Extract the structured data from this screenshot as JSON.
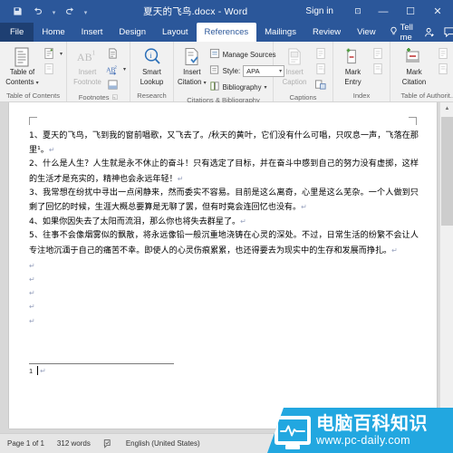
{
  "titlebar": {
    "document_title": "夏天的飞鸟.docx  -  Word",
    "signin_label": "Sign in",
    "qat": [
      {
        "name": "save",
        "icon": "save-icon"
      },
      {
        "name": "undo",
        "icon": "undo-icon"
      },
      {
        "name": "redo",
        "icon": "redo-icon"
      },
      {
        "name": "customize",
        "icon": "chevron-down-icon"
      }
    ],
    "window_controls": {
      "ribbon_display": "⊡",
      "minimize": "—",
      "maximize": "☐",
      "close": "✕"
    }
  },
  "tabs": [
    {
      "label": "File",
      "active": false,
      "file": true
    },
    {
      "label": "Home",
      "active": false
    },
    {
      "label": "Insert",
      "active": false
    },
    {
      "label": "Design",
      "active": false
    },
    {
      "label": "Layout",
      "active": false
    },
    {
      "label": "References",
      "active": true
    },
    {
      "label": "Mailings",
      "active": false
    },
    {
      "label": "Review",
      "active": false
    },
    {
      "label": "View",
      "active": false
    }
  ],
  "tellme": {
    "label": "Tell me"
  },
  "ribbon": {
    "groups": [
      {
        "label": "Table of Contents",
        "has_dialog_launcher": false,
        "big_buttons": [
          {
            "label_line1": "Table of",
            "label_line2": "Contents",
            "icon": "toc-icon",
            "dropdown": true,
            "disabled": false
          }
        ],
        "small_buttons": [
          {
            "name": "add-text",
            "icon": "add-text-icon",
            "dropdown": true,
            "disabled": false
          },
          {
            "name": "update-table",
            "icon": "update-table-icon",
            "dropdown": false,
            "disabled": true
          }
        ]
      },
      {
        "label": "Footnotes",
        "has_dialog_launcher": true,
        "big_buttons": [
          {
            "label_line1": "Insert",
            "label_line2": "Footnote",
            "icon": "insert-footnote-icon",
            "dropdown": false,
            "disabled": true
          }
        ],
        "small_buttons": [
          {
            "name": "insert-endnote",
            "icon": "insert-endnote-icon",
            "dropdown": false,
            "disabled": false
          },
          {
            "name": "next-footnote",
            "icon": "next-footnote-icon",
            "dropdown": true,
            "disabled": false
          },
          {
            "name": "show-notes",
            "icon": "show-notes-icon",
            "dropdown": false,
            "disabled": false
          }
        ]
      },
      {
        "label": "Research",
        "has_dialog_launcher": false,
        "big_buttons": [
          {
            "label_line1": "Smart",
            "label_line2": "Lookup",
            "icon": "smart-lookup-icon",
            "dropdown": false,
            "disabled": false
          }
        ],
        "small_buttons": []
      },
      {
        "label": "Citations & Bibliography",
        "has_dialog_launcher": false,
        "big_buttons": [
          {
            "label_line1": "Insert",
            "label_line2": "Citation",
            "icon": "insert-citation-icon",
            "dropdown": true,
            "disabled": false
          }
        ],
        "text_buttons": [
          {
            "label": "Manage Sources",
            "icon": "manage-sources-icon",
            "dropdown": false
          },
          {
            "label": "Style:",
            "icon": "style-icon",
            "value": "APA",
            "is_select": true
          },
          {
            "label": "Bibliography",
            "icon": "bibliography-icon",
            "dropdown": true
          }
        ]
      },
      {
        "label": "Captions",
        "has_dialog_launcher": false,
        "big_buttons": [
          {
            "label_line1": "Insert",
            "label_line2": "Caption",
            "icon": "insert-caption-icon",
            "dropdown": false,
            "disabled": true
          }
        ],
        "small_buttons": [
          {
            "name": "insert-table-of-figures",
            "icon": "table-of-figures-icon",
            "dropdown": false,
            "disabled": true
          },
          {
            "name": "update-table-figures",
            "icon": "update-table-icon",
            "dropdown": false,
            "disabled": true
          },
          {
            "name": "cross-reference",
            "icon": "cross-reference-icon",
            "dropdown": false,
            "disabled": false
          }
        ]
      },
      {
        "label": "Index",
        "has_dialog_launcher": false,
        "big_buttons": [
          {
            "label_line1": "Mark",
            "label_line2": "Entry",
            "icon": "mark-entry-icon",
            "dropdown": false,
            "disabled": false
          }
        ],
        "small_buttons": [
          {
            "name": "insert-index",
            "icon": "insert-index-icon",
            "dropdown": false,
            "disabled": true
          },
          {
            "name": "update-index",
            "icon": "update-index-icon",
            "dropdown": false,
            "disabled": true
          }
        ]
      },
      {
        "label": "Table of Authorit...",
        "has_dialog_launcher": false,
        "big_buttons": [
          {
            "label_line1": "Mark",
            "label_line2": "Citation",
            "icon": "mark-citation-icon",
            "dropdown": false,
            "disabled": false
          }
        ],
        "small_buttons": [
          {
            "name": "insert-table-of-authorities",
            "icon": "insert-authorities-icon",
            "dropdown": false,
            "disabled": true
          },
          {
            "name": "update-table-authorities",
            "icon": "update-table-icon",
            "dropdown": false,
            "disabled": true
          }
        ]
      }
    ],
    "collapse_ribbon": "⌃"
  },
  "document": {
    "paragraphs": [
      "1、夏天的飞鸟，飞到我的窗前唱歌，又飞去了。/秋天的黄叶，它们没有什么可唱，只叹息一声，飞落在那里¹。",
      "2、什么是人生？人生就是永不休止的奋斗！只有选定了目标，并在奋斗中感到自己的努力没有虚掷，这样的生活才是充实的，精神也会永远年轻！",
      "3、我常想在纷扰中寻出一点闲静来，然而委实不容易。目前是这么离奇，心里是这么芜杂。一个人做到只剩了回忆的时候，生涯大概总要算是无聊了罢，但有时竟会连回忆也没有。",
      "4、如果你因失去了太阳而流泪，那么你也将失去群星了。",
      "5、往事不会像烟雾似的飘散，将永远像铅一般沉重地浇铸在心灵的深处。不过，日常生活的纷繁不会让人专注地沉湎于自己的痛苦不幸。即使人的心灵伤痕累累，也还得要去为现实中的生存和发展而挣扎。"
    ],
    "pilcrow": "↵",
    "blank_line_count": 5,
    "footnote_number": "1"
  },
  "statusbar": {
    "page": "Page 1 of 1",
    "words": "312 words",
    "proofing_icon": "proofing-icon",
    "language": "English (United States)"
  },
  "watermark": {
    "chinese": "电脑百科知识",
    "url": "www.pc-daily.com"
  }
}
